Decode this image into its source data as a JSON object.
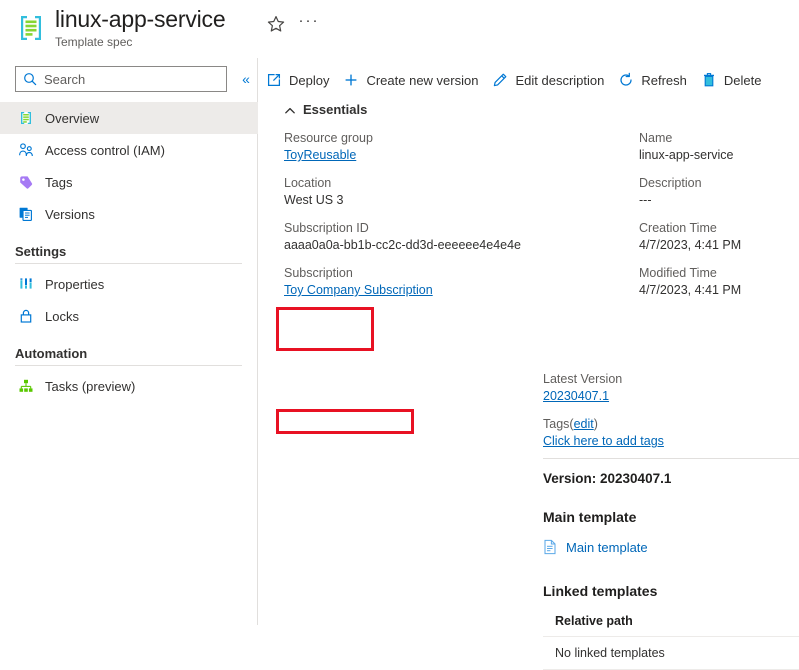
{
  "header": {
    "title": "linux-app-service",
    "subtitle": "Template spec",
    "resource_icon": "template-spec-icon",
    "favorite_icon": "star-icon",
    "more_label": "···"
  },
  "sidebar": {
    "search": {
      "placeholder": "Search",
      "value": "",
      "icon": "search-icon"
    },
    "collapse_icon": "«",
    "items": [
      {
        "label": "Overview",
        "icon": "template-spec-icon",
        "selected": true
      },
      {
        "label": "Access control (IAM)",
        "icon": "people-icon",
        "selected": false
      },
      {
        "label": "Tags",
        "icon": "tag-icon",
        "selected": false
      },
      {
        "label": "Versions",
        "icon": "versions-icon",
        "selected": false
      }
    ],
    "groups": [
      {
        "title": "Settings",
        "items": [
          {
            "label": "Properties",
            "icon": "properties-icon"
          },
          {
            "label": "Locks",
            "icon": "lock-icon"
          }
        ]
      },
      {
        "title": "Automation",
        "items": [
          {
            "label": "Tasks (preview)",
            "icon": "tasks-icon"
          }
        ]
      }
    ]
  },
  "toolbar": {
    "buttons": [
      {
        "label": "Deploy",
        "icon": "deploy-launch-icon"
      },
      {
        "label": "Create new version",
        "icon": "plus-icon"
      },
      {
        "label": "Edit description",
        "icon": "pencil-icon"
      },
      {
        "label": "Refresh",
        "icon": "refresh-icon"
      },
      {
        "label": "Delete",
        "icon": "trash-icon"
      }
    ]
  },
  "essentials": {
    "section_label": "Essentials",
    "collapse_icon": "chevron-up-icon",
    "left": [
      {
        "key": "Resource group",
        "value": "ToyReusable",
        "is_link": true
      },
      {
        "key": "Location",
        "value": "West US 3",
        "is_link": false
      },
      {
        "key": "Subscription ID",
        "value": "aaaa0a0a-bb1b-cc2c-dd3d-eeeeee4e4e4e",
        "is_link": false
      },
      {
        "key": "Subscription",
        "value": "Toy Company Subscription",
        "is_link": true
      }
    ],
    "right": [
      {
        "key": "Name",
        "value": "linux-app-service",
        "is_link": false
      },
      {
        "key": "Description",
        "value": "---",
        "is_link": false
      },
      {
        "key": "Creation Time",
        "value": "4/7/2023, 4:41 PM",
        "is_link": false
      },
      {
        "key": "Modified Time",
        "value": "4/7/2023, 4:41 PM",
        "is_link": false
      }
    ],
    "latest_version": {
      "key": "Latest Version",
      "value": "20230407.1"
    },
    "tags": {
      "label": "Tags",
      "edit_open": "(",
      "edit_label": "edit",
      "edit_close": ")",
      "add_link": "Click here to add tags"
    }
  },
  "version_section": {
    "heading": "Version: 20230407.1"
  },
  "main_template": {
    "heading": "Main template",
    "link_label": "Main template",
    "link_icon": "document-icon"
  },
  "linked_templates": {
    "heading": "Linked templates",
    "column_header": "Relative path",
    "empty_row": "No linked templates"
  },
  "highlights": {
    "box_color": "#e81123",
    "boxes": [
      "latest-version",
      "version-heading"
    ]
  }
}
